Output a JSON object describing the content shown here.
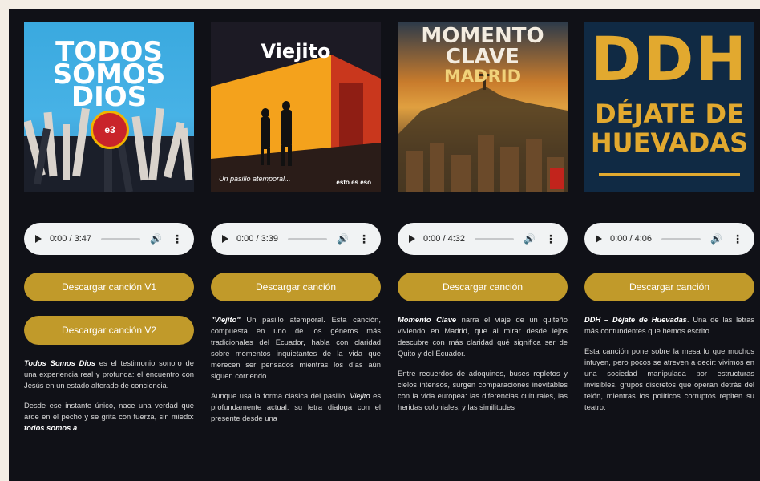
{
  "songs": [
    {
      "cover": {
        "line1": "TODOS",
        "line2": "SOMOS",
        "line3": "DIOS",
        "badge": "e3"
      },
      "player": {
        "time": "0:00 / 3:47"
      },
      "buttons": [
        "Descargar canción V1",
        "Descargar canción V2"
      ],
      "desc": {
        "p1_title": "Todos Somos Dios",
        "p1_text": " es el testimonio sonoro de una experiencia real y profunda: el encuentro con Jesús en un estado alterado de conciencia.",
        "p2_text": "Desde ese instante único, nace una verdad que arde en el pecho y se grita con fuerza, sin miedo: ",
        "p2_bold": "todos somos a"
      }
    },
    {
      "cover": {
        "title": "Viejito",
        "subtitle": "Un pasillo atemporal...",
        "logo": "esto es eso"
      },
      "player": {
        "time": "0:00 / 3:39"
      },
      "buttons": [
        "Descargar canción"
      ],
      "desc": {
        "p1_title": "\"Viejito\"",
        "p1_text": " Un pasillo atemporal. Esta canción, compuesta en uno de los géneros más tradicionales del Ecuador, habla con claridad sobre momentos inquietantes de la vida que merecen ser pensados mientras los días aún siguen corriendo.",
        "p2_text": "Aunque usa la forma clásica del pasillo, ",
        "p2_italic": "Viejito",
        "p2_text2": " es profundamente actual: su letra dialoga con el presente desde una"
      }
    },
    {
      "cover": {
        "line1": "MOMENTO",
        "line2": "CLAVE",
        "line3": "MADRID"
      },
      "player": {
        "time": "0:00 / 4:32"
      },
      "buttons": [
        "Descargar canción"
      ],
      "desc": {
        "p1_title": "Momento Clave",
        "p1_text": " narra el viaje de un quiteño viviendo en Madrid, que al mirar desde lejos descubre con más claridad qué significa ser de Quito y del Ecuador.",
        "p2_text": "Entre recuerdos de adoquines, buses repletos y cielos intensos, surgen comparaciones inevitables con la vida europea: las diferencias culturales, las heridas coloniales, y las similitudes"
      }
    },
    {
      "cover": {
        "big": "DDH",
        "line1": "DÉJATE DE",
        "line2": "HUEVADAS"
      },
      "player": {
        "time": "0:00 / 4:06"
      },
      "buttons": [
        "Descargar canción"
      ],
      "desc": {
        "p1_title": "DDH – Déjate de Huevadas",
        "p1_text": ". Una de las letras más contundentes que hemos escrito.",
        "p2_text": "Esta canción pone sobre la mesa lo que muchos intuyen, pero pocos se atreven a decir: vivimos en una sociedad manipulada por estructuras invisibles, grupos discretos que operan detrás del telón, mientras los políticos corruptos repiten su teatro."
      }
    }
  ],
  "icons": {
    "play": "play-icon",
    "volume": "volume-icon",
    "more": "more-vert-icon"
  },
  "colors": {
    "background": "#101117",
    "accent": "#c19a2a",
    "player": "#f1f3f4"
  }
}
